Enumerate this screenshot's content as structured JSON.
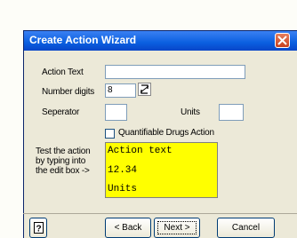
{
  "window": {
    "title": "Create Action Wizard"
  },
  "form": {
    "action_text_label": "Action Text",
    "action_text_value": "",
    "number_digits_label": "Number digits",
    "number_digits_value": "8",
    "separator_label": "Seperator",
    "separator_value": "",
    "units_label": "Units",
    "units_value": "",
    "quantifiable_label": "Quantifiable Drugs Action",
    "quantifiable_checked": false
  },
  "test": {
    "label_line1": "Test the action",
    "label_line2": "by typing into",
    "label_line3": "the edit box  ->",
    "line1": "Action text",
    "line2": "12.34",
    "line3": "Units"
  },
  "buttons": {
    "help_label": "?",
    "back_label": "< Back",
    "next_label": "Next >",
    "cancel_label": "Cancel"
  },
  "icons": {
    "close": "close-icon",
    "spin": "spin-arrows-icon",
    "help": "help-icon"
  }
}
